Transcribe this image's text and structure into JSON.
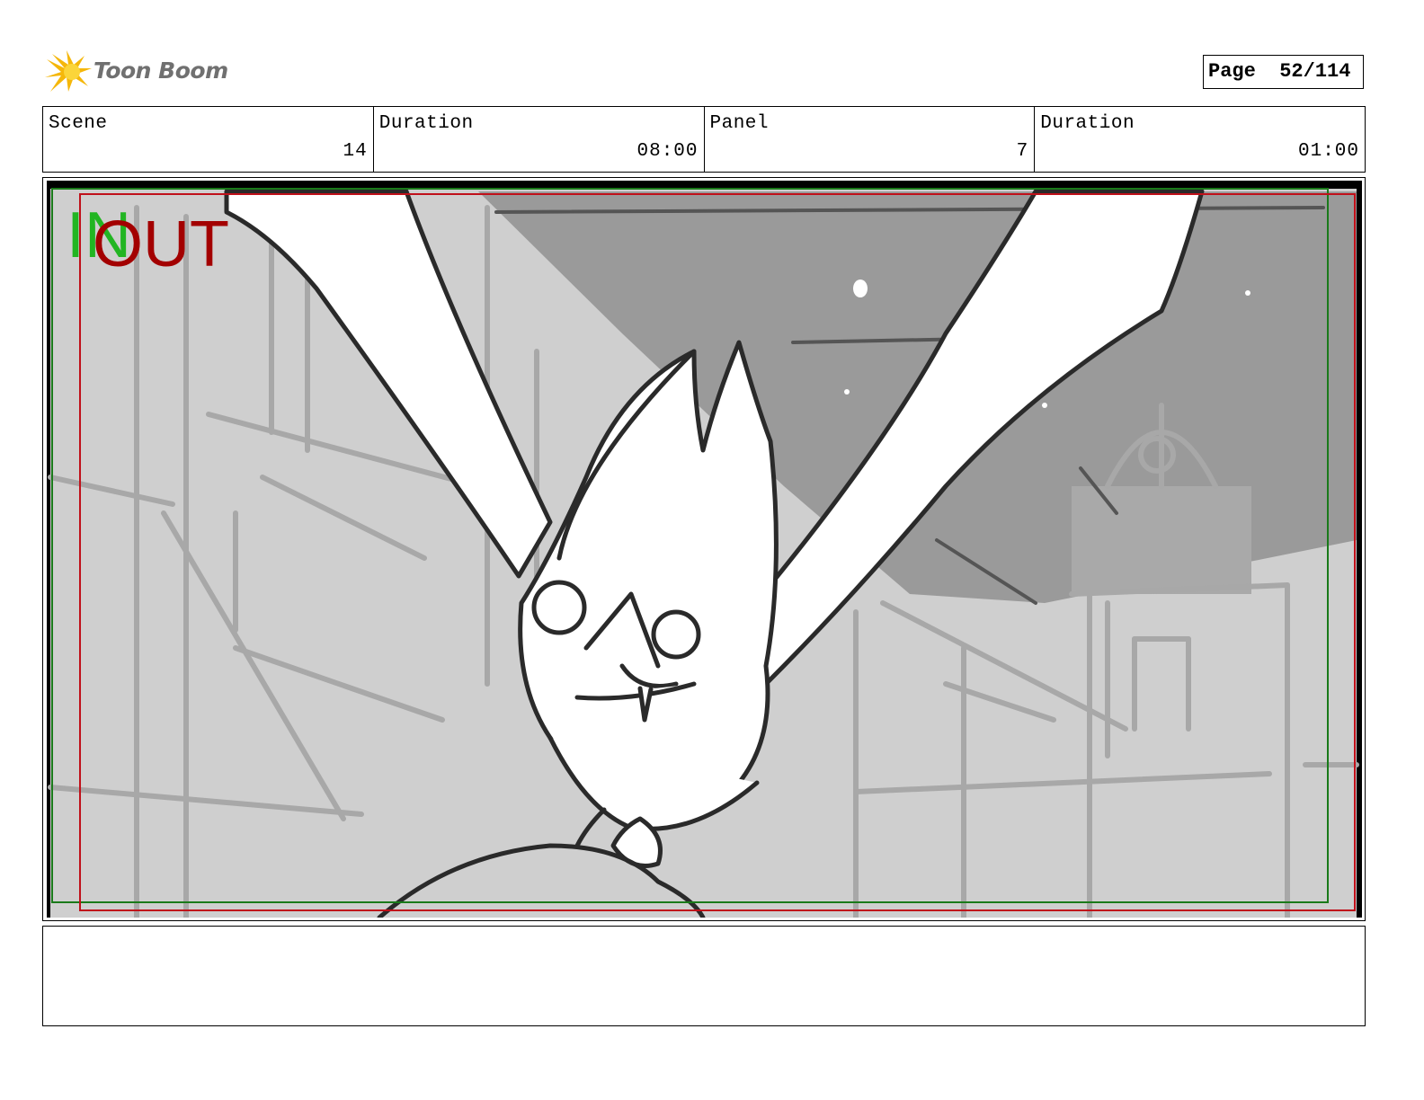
{
  "header": {
    "logo_text": "Toon Boom",
    "page_label": "Page",
    "page_number": "52/114"
  },
  "info": {
    "scene_label": "Scene",
    "scene_value": "14",
    "scene_duration_label": "Duration",
    "scene_duration_value": "08:00",
    "panel_label": "Panel",
    "panel_value": "7",
    "panel_duration_label": "Duration",
    "panel_duration_value": "01:00"
  },
  "panel": {
    "in_marker": "IN",
    "out_marker": "OUT",
    "safe_frame_color": "#1a7a1a",
    "camera_frame_color": "#c0101a"
  },
  "notes": {
    "text": ""
  }
}
